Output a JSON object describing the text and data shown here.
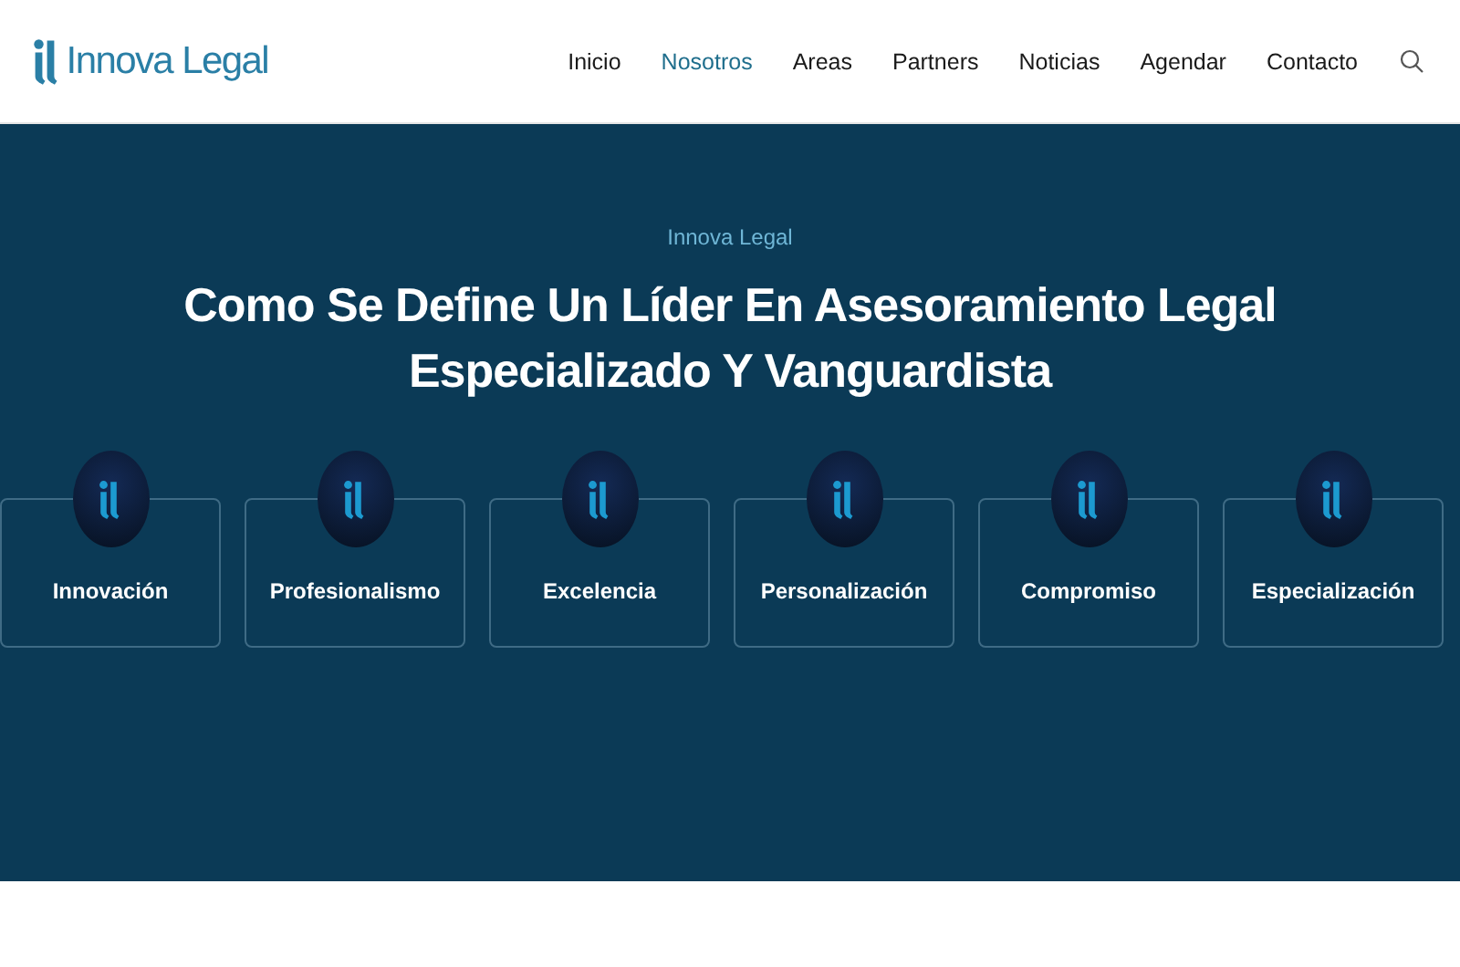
{
  "header": {
    "logo_text": "Innova Legal",
    "nav": [
      {
        "label": "Inicio",
        "selected": false
      },
      {
        "label": "Nosotros",
        "selected": true
      },
      {
        "label": "Areas",
        "selected": false
      },
      {
        "label": "Partners",
        "selected": false
      },
      {
        "label": "Noticias",
        "selected": false
      },
      {
        "label": "Agendar",
        "selected": false
      },
      {
        "label": "Contacto",
        "selected": false
      }
    ]
  },
  "hero": {
    "eyebrow": "Innova Legal",
    "title_lines": [
      "Como Se Define Un Líder En Asesoramiento Legal",
      "Especializado Y Vanguardista"
    ],
    "values": [
      {
        "label": "Innovación"
      },
      {
        "label": "Profesionalismo"
      },
      {
        "label": "Excelencia"
      },
      {
        "label": "Personalización"
      },
      {
        "label": "Compromiso"
      },
      {
        "label": "Especialización"
      }
    ]
  }
}
